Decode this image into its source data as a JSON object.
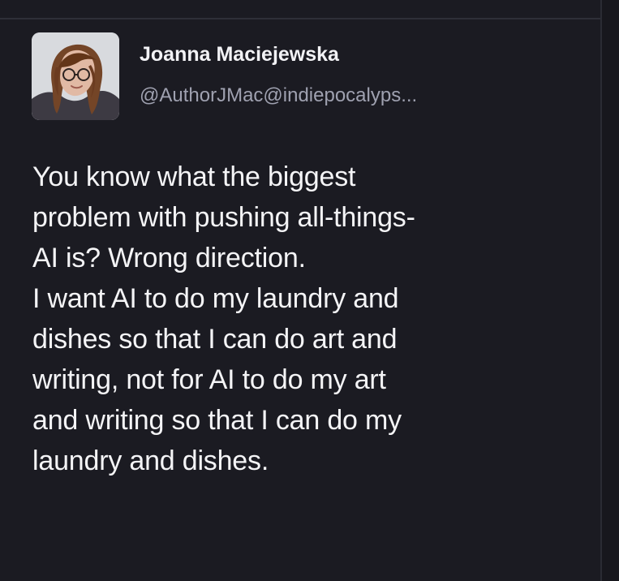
{
  "post": {
    "author": {
      "display_name": "Joanna Maciejewska",
      "handle": "@AuthorJMac@indiepocalyps..."
    },
    "text_lines": [
      "You know what the biggest",
      "problem with pushing all-things-",
      "AI is? Wrong direction.",
      "I want AI to do my laundry and",
      "dishes so that I can do art and",
      "writing, not for AI to do my art",
      "and writing so that I can do my",
      "laundry and dishes."
    ]
  },
  "colors": {
    "background": "#1b1b22",
    "text_primary": "#f4f4f6",
    "text_secondary": "#9fa1b0"
  }
}
